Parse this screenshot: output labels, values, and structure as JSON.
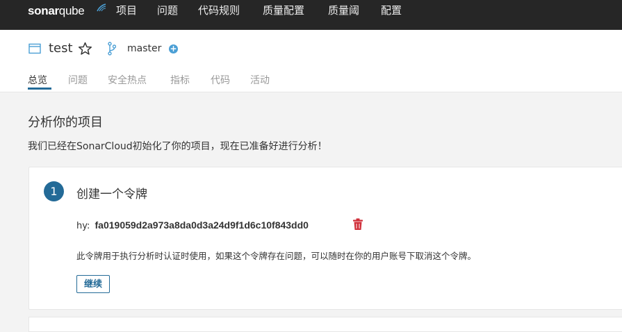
{
  "app": {
    "logo_text": "sonar",
    "logo_text_bold": "qube"
  },
  "topnav": {
    "items": [
      "项目",
      "问题",
      "代码规则",
      "质量配置",
      "质量阈",
      "配置"
    ]
  },
  "project": {
    "name": "test",
    "branch": "master",
    "add_branch_glyph": "+"
  },
  "tabs": [
    "总览",
    "问题",
    "安全热点",
    "指标",
    "代码",
    "活动"
  ],
  "main": {
    "title": "分析你的项目",
    "subtitle": "我们已经在SonarCloud初始化了你的项目，现在已准备好进行分析！"
  },
  "step1": {
    "number": "1",
    "title": "创建一个令牌",
    "token_prefix": "hy:",
    "token_value": "fa019059d2a973a8da0d3a24d9f1d6c10f843dd0",
    "description": "此令牌用于执行分析时认证时使用，如果这个令牌存在问题，可以随时在你的用户账号下取消这个令牌。",
    "continue_label": "继续"
  },
  "colors": {
    "topbar": "#262626",
    "accent": "#236a97",
    "delete": "#d02f3a",
    "branch_plus": "#4b9fd5"
  },
  "icons": {
    "project": "folder-icon",
    "favorite": "star-icon",
    "branch": "branch-icon",
    "delete": "trash-icon"
  }
}
